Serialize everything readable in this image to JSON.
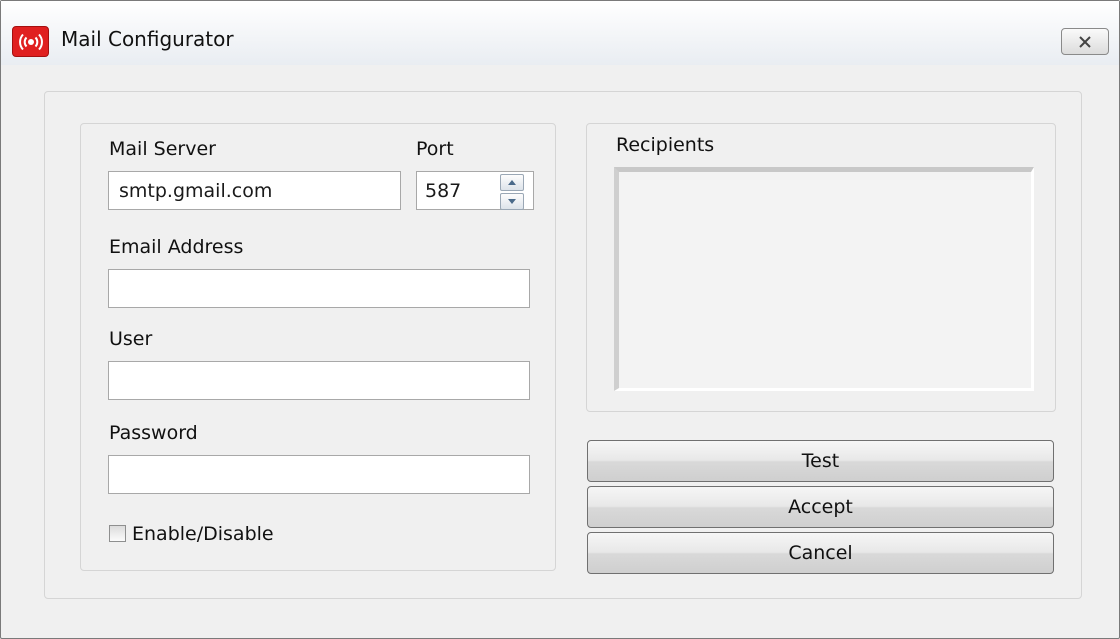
{
  "window": {
    "title": "Mail Configurator",
    "icon": "broadcast-icon",
    "close_icon": "close-icon"
  },
  "form": {
    "mail_server": {
      "label": "Mail Server",
      "value": "smtp.gmail.com"
    },
    "port": {
      "label": "Port",
      "value": "587"
    },
    "email": {
      "label": "Email Address",
      "value": ""
    },
    "user": {
      "label": "User",
      "value": ""
    },
    "password": {
      "label": "Password",
      "value": ""
    },
    "enable": {
      "label": "Enable/Disable",
      "checked": false
    }
  },
  "recipients": {
    "label": "Recipients",
    "items": []
  },
  "buttons": {
    "test": "Test",
    "accept": "Accept",
    "cancel": "Cancel"
  },
  "colors": {
    "app_icon": "#e02020"
  }
}
